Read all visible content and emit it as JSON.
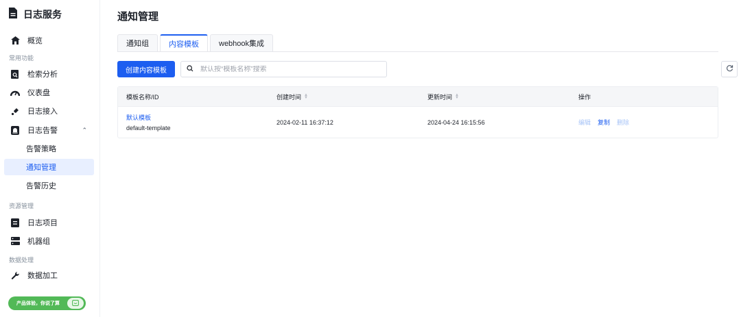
{
  "sidebar": {
    "brand": "日志服务",
    "items": {
      "overview": "概览",
      "section_common": "常用功能",
      "search_analysis": "检索分析",
      "dashboard": "仪表盘",
      "log_ingest": "日志接入",
      "log_alert": "日志告警",
      "alert_policy": "告警策略",
      "notify_mgmt": "通知管理",
      "alert_history": "告警历史",
      "section_resource": "资源管理",
      "log_project": "日志项目",
      "machine_group": "机器组",
      "section_data": "数据处理",
      "data_processing": "数据加工"
    },
    "feedback": "产品体验，你说了算"
  },
  "main": {
    "title": "通知管理",
    "tabs": [
      "通知组",
      "内容模板",
      "webhook集成"
    ],
    "active_tab": "内容模板",
    "create_button": "创建内容模板",
    "search_placeholder": "默认按“模板名称”搜索"
  },
  "table": {
    "columns": [
      "模板名称/ID",
      "创建时间",
      "更新时间",
      "操作"
    ],
    "rows": [
      {
        "name": "默认模板",
        "id": "default-template",
        "created": "2024-02-11 16:37:12",
        "updated": "2024-04-24 16:15:56",
        "actions": [
          "编辑",
          "复制",
          "删除"
        ]
      }
    ]
  },
  "colors": {
    "accent": "#1d5ef0",
    "feedback_green": "#52b957"
  }
}
